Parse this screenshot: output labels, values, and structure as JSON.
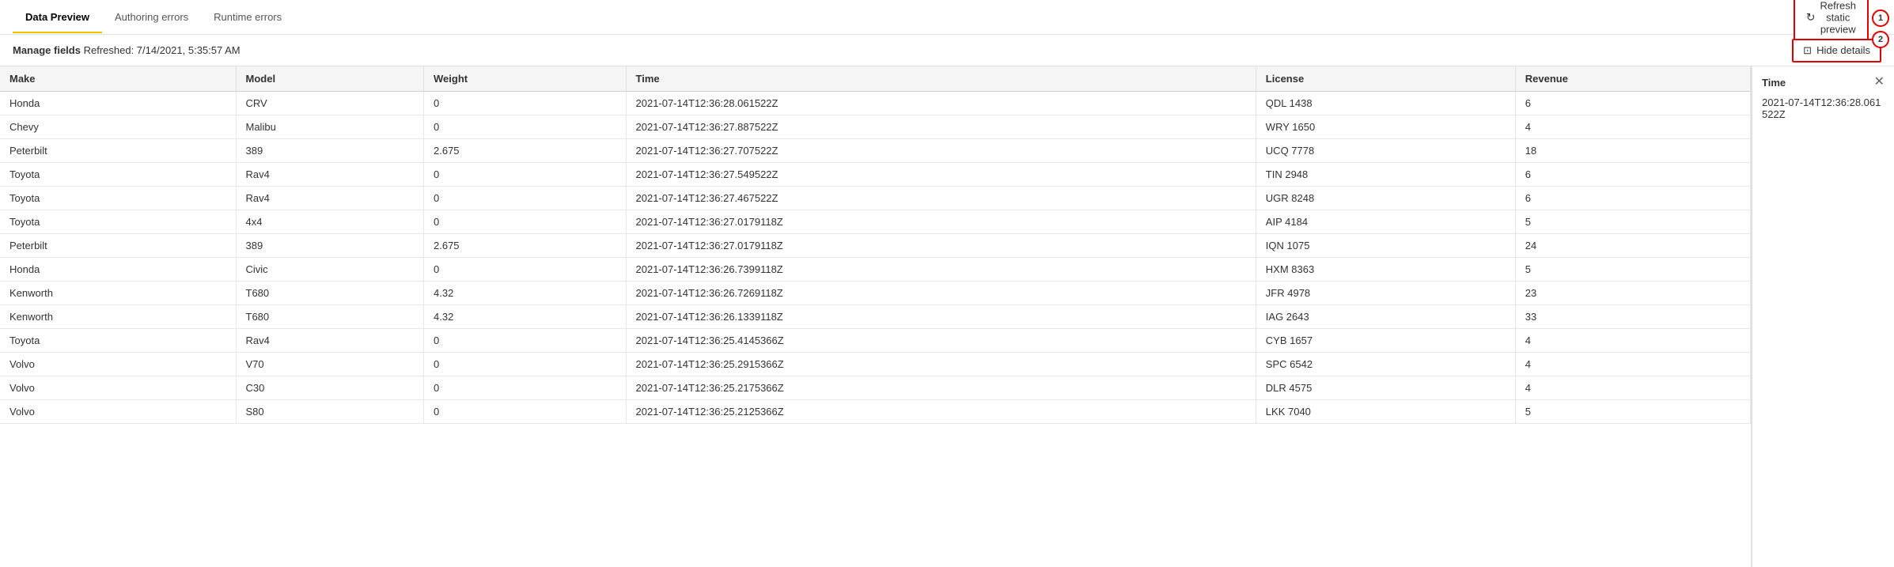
{
  "tabs": [
    {
      "id": "data-preview",
      "label": "Data Preview",
      "active": true
    },
    {
      "id": "authoring-errors",
      "label": "Authoring errors",
      "active": false
    },
    {
      "id": "runtime-errors",
      "label": "Runtime errors",
      "active": false
    }
  ],
  "toolbar": {
    "refresh_label": "Refresh static preview",
    "refresh_badge": "1",
    "hide_details_label": "Hide details",
    "hide_details_badge": "2"
  },
  "subheader": {
    "manage_fields_label": "Manage fields",
    "refreshed_label": "Refreshed: 7/14/2021, 5:35:57 AM"
  },
  "table": {
    "columns": [
      "Make",
      "Model",
      "Weight",
      "Time",
      "License",
      "Revenue"
    ],
    "rows": [
      {
        "make": "Honda",
        "model": "CRV",
        "weight": "0",
        "time": "2021-07-14T12:36:28.061522Z",
        "license": "QDL 1438",
        "revenue": "6"
      },
      {
        "make": "Chevy",
        "model": "Malibu",
        "weight": "0",
        "time": "2021-07-14T12:36:27.887522Z",
        "license": "WRY 1650",
        "revenue": "4"
      },
      {
        "make": "Peterbilt",
        "model": "389",
        "weight": "2.675",
        "time": "2021-07-14T12:36:27.707522Z",
        "license": "UCQ 7778",
        "revenue": "18"
      },
      {
        "make": "Toyota",
        "model": "Rav4",
        "weight": "0",
        "time": "2021-07-14T12:36:27.549522Z",
        "license": "TIN 2948",
        "revenue": "6"
      },
      {
        "make": "Toyota",
        "model": "Rav4",
        "weight": "0",
        "time": "2021-07-14T12:36:27.467522Z",
        "license": "UGR 8248",
        "revenue": "6"
      },
      {
        "make": "Toyota",
        "model": "4x4",
        "weight": "0",
        "time": "2021-07-14T12:36:27.0179118Z",
        "license": "AIP 4184",
        "revenue": "5"
      },
      {
        "make": "Peterbilt",
        "model": "389",
        "weight": "2.675",
        "time": "2021-07-14T12:36:27.0179118Z",
        "license": "IQN 1075",
        "revenue": "24"
      },
      {
        "make": "Honda",
        "model": "Civic",
        "weight": "0",
        "time": "2021-07-14T12:36:26.7399118Z",
        "license": "HXM 8363",
        "revenue": "5"
      },
      {
        "make": "Kenworth",
        "model": "T680",
        "weight": "4.32",
        "time": "2021-07-14T12:36:26.7269118Z",
        "license": "JFR 4978",
        "revenue": "23"
      },
      {
        "make": "Kenworth",
        "model": "T680",
        "weight": "4.32",
        "time": "2021-07-14T12:36:26.1339118Z",
        "license": "IAG 2643",
        "revenue": "33"
      },
      {
        "make": "Toyota",
        "model": "Rav4",
        "weight": "0",
        "time": "2021-07-14T12:36:25.4145366Z",
        "license": "CYB 1657",
        "revenue": "4"
      },
      {
        "make": "Volvo",
        "model": "V70",
        "weight": "0",
        "time": "2021-07-14T12:36:25.2915366Z",
        "license": "SPC 6542",
        "revenue": "4"
      },
      {
        "make": "Volvo",
        "model": "C30",
        "weight": "0",
        "time": "2021-07-14T12:36:25.2175366Z",
        "license": "DLR 4575",
        "revenue": "4"
      },
      {
        "make": "Volvo",
        "model": "S80",
        "weight": "0",
        "time": "2021-07-14T12:36:25.2125366Z",
        "license": "LKK 7040",
        "revenue": "5"
      }
    ]
  },
  "side_panel": {
    "title": "Time",
    "value": "2021-07-14T12:36:28.061522Z"
  }
}
